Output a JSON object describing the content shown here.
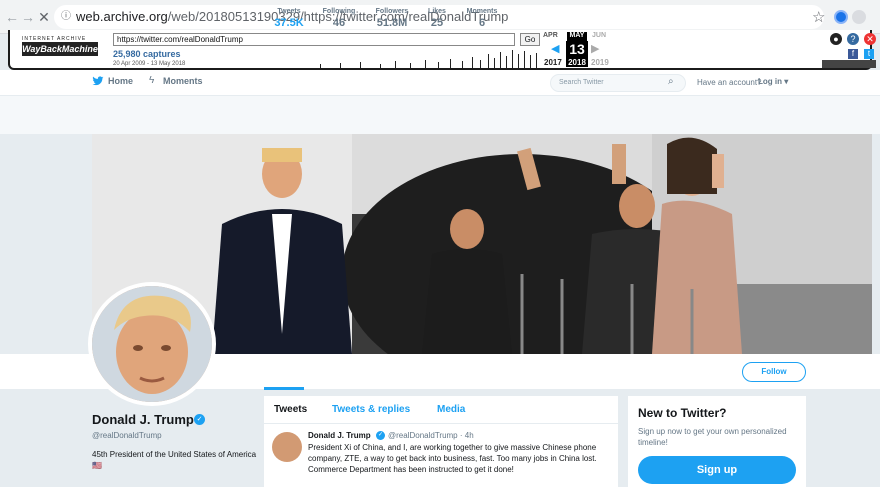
{
  "browser": {
    "url_host": "web.archive.org",
    "url_path": "/web/20180513190329/https://twitter.com/realDonaldTrump"
  },
  "wayback": {
    "logo_top": "INTERNET ARCHIVE",
    "logo": "WayBackMachine",
    "url_value": "https://twitter.com/realDonaldTrump",
    "go_label": "Go",
    "captures": "25,980 captures",
    "date_range": "20 Apr 2009 - 13 May 2018",
    "months": [
      "APR",
      "MAY",
      "JUN"
    ],
    "day": "13",
    "years": [
      "2017",
      "2018",
      "2019"
    ]
  },
  "topnav": {
    "home": "Home",
    "moments": "Moments",
    "search_placeholder": "Search Twitter",
    "have_account": "Have an account?",
    "login": "Log in"
  },
  "profile": {
    "name": "Donald J. Trump",
    "handle": "@realDonaldTrump",
    "bio": "45th President of the United States of America🇺🇸",
    "follow_label": "Follow",
    "stats": [
      {
        "label": "Tweets",
        "value": "37.5K"
      },
      {
        "label": "Following",
        "value": "46"
      },
      {
        "label": "Followers",
        "value": "51.8M"
      },
      {
        "label": "Likes",
        "value": "25"
      },
      {
        "label": "Moments",
        "value": "6"
      }
    ]
  },
  "timeline": {
    "tabs": [
      "Tweets",
      "Tweets & replies",
      "Media"
    ],
    "tweet": {
      "name": "Donald J. Trump",
      "handle_time": "@realDonaldTrump · 4h",
      "text": "President Xi of China, and I, are working together to give massive Chinese phone company, ZTE, a way to get back into business, fast. Too many jobs in China lost. Commerce Department has been instructed to get it done!"
    }
  },
  "signup_card": {
    "title": "New to Twitter?",
    "text": "Sign up now to get your own personalized timeline!",
    "button": "Sign up"
  },
  "colors": {
    "twitter_blue": "#1da1f2",
    "grey_text": "#657786",
    "page_bg": "#e6ecf0"
  }
}
